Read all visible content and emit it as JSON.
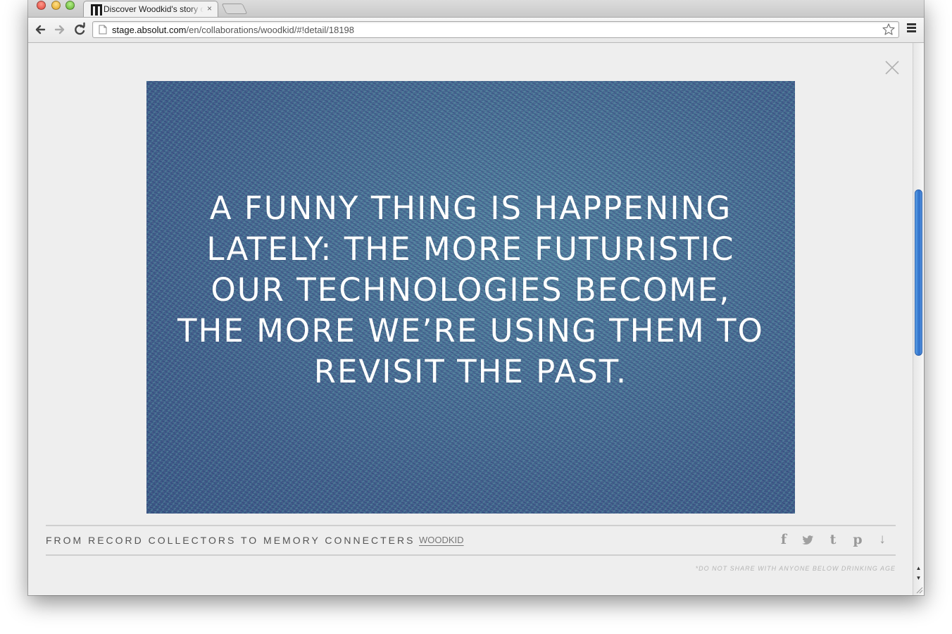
{
  "browser": {
    "tab_title": "Discover Woodkid's story o",
    "tab_close": "×",
    "url_host": "stage.absolut.com",
    "url_path": "/en/collaborations/woodkid/#!detail/18198"
  },
  "icons": {
    "back": "back-arrow-icon",
    "forward": "forward-arrow-icon",
    "reload": "reload-icon",
    "page": "page-icon",
    "bookmark": "star-icon",
    "menu": "hamburger-menu-icon",
    "close": "close-icon"
  },
  "hero": {
    "quote": "A FUNNY THING IS HAPPENING LATELY: THE MORE FUTURISTIC OUR TECHNOLOGIES BECOME, THE MORE WE’RE USING THEM TO REVISIT THE PAST."
  },
  "caption": {
    "title": "FROM RECORD COLLECTORS TO MEMORY CONNECTERS",
    "tag": "WOODKID"
  },
  "social": {
    "facebook": "f",
    "twitter": "❧",
    "tumblr": "t",
    "pinterest": "p",
    "download": "↓"
  },
  "footer": {
    "disclaimer": "*DO NOT SHARE WITH ANYONE BELOW DRINKING AGE"
  },
  "scroll": {
    "up": "▲",
    "down": "▼"
  }
}
